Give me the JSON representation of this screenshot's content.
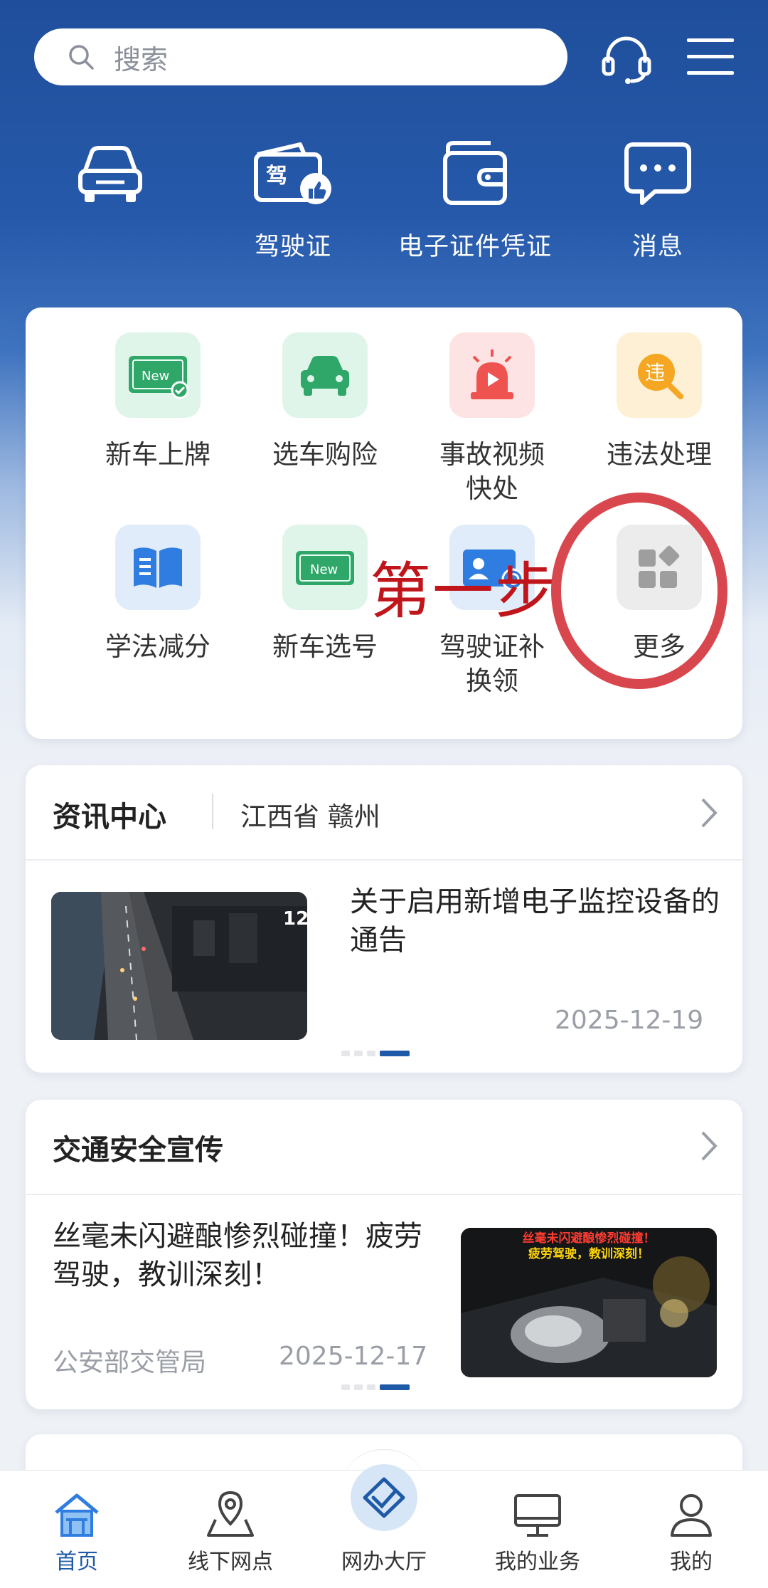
{
  "search": {
    "placeholder": "搜索"
  },
  "quick_actions": [
    {
      "label": "",
      "icon": "car-icon"
    },
    {
      "label": "驾驶证",
      "icon": "license-icon"
    },
    {
      "label": "电子证件凭证",
      "icon": "wallet-icon"
    },
    {
      "label": "消息",
      "icon": "message-icon"
    }
  ],
  "services": [
    {
      "label": "新车上牌",
      "icon": "new-plate-icon"
    },
    {
      "label": "选车购险",
      "icon": "car-insurance-icon"
    },
    {
      "label": "事故视频\n快处",
      "icon": "alarm-video-icon"
    },
    {
      "label": "违法处理",
      "icon": "violation-search-icon"
    },
    {
      "label": "学法减分",
      "icon": "book-icon"
    },
    {
      "label": "新车选号",
      "icon": "new-number-icon"
    },
    {
      "label": "驾驶证补\n换领",
      "icon": "id-card-icon"
    },
    {
      "label": "更多",
      "icon": "more-grid-icon"
    }
  ],
  "annotation": {
    "text": "第一步"
  },
  "news_center": {
    "title": "资讯中心",
    "region": "江西省 赣州",
    "article": {
      "title": "关于启用新增电子监控设备的通告",
      "date": "2025-12-19"
    }
  },
  "traffic_safety": {
    "title": "交通安全宣传",
    "article": {
      "title": "丝毫未闪避酿惨烈碰撞！疲劳驾驶，教训深刻！",
      "source": "公安部交管局",
      "date": "2025-12-17",
      "thumb_caption_1": "丝毫未闪避酿惨烈碰撞！",
      "thumb_caption_2": "疲劳驾驶，教训深刻！"
    }
  },
  "tabbar": [
    {
      "label": "首页",
      "active": true
    },
    {
      "label": "线下网点",
      "active": false
    },
    {
      "label": "网办大厅",
      "active": false
    },
    {
      "label": "我的业务",
      "active": false
    },
    {
      "label": "我的",
      "active": false
    }
  ],
  "colors": {
    "brand_blue": "#1f5aa8",
    "annotation_red": "#c0161b"
  }
}
